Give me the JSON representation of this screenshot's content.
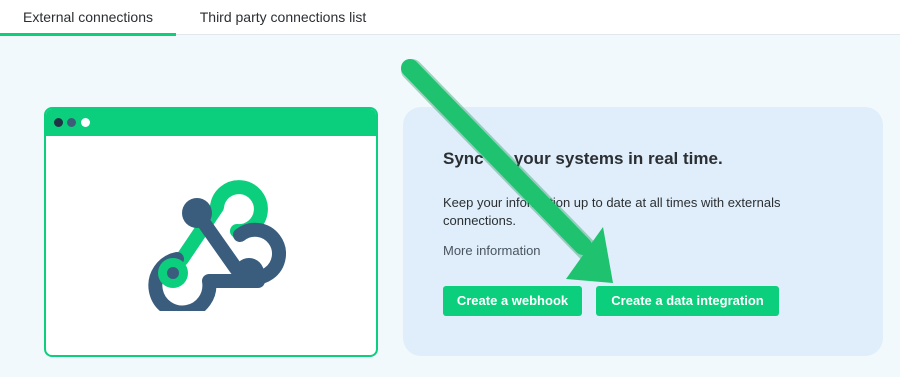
{
  "tabs": [
    {
      "label": "External connections",
      "active": true
    },
    {
      "label": "Third party connections list",
      "active": false
    }
  ],
  "illustration": {
    "icon": "webhook-icon",
    "window_dots": [
      "#1f3344",
      "#3d5c78",
      "#ffffff"
    ]
  },
  "info": {
    "title": "Sync up your systems in real time.",
    "description": "Keep your information up to date at all times with externals connections.",
    "more_link": "More information"
  },
  "actions": {
    "webhook_label": "Create a webhook",
    "data_integration_label": "Create a data integration"
  },
  "annotation": {
    "icon": "arrow-icon",
    "color": "#1ec26f"
  },
  "colors": {
    "accent": "#0ccf7d",
    "logo_dark": "#3a5d7e",
    "card_bg": "#dfeefa",
    "page_bg": "#f2f9fd"
  }
}
